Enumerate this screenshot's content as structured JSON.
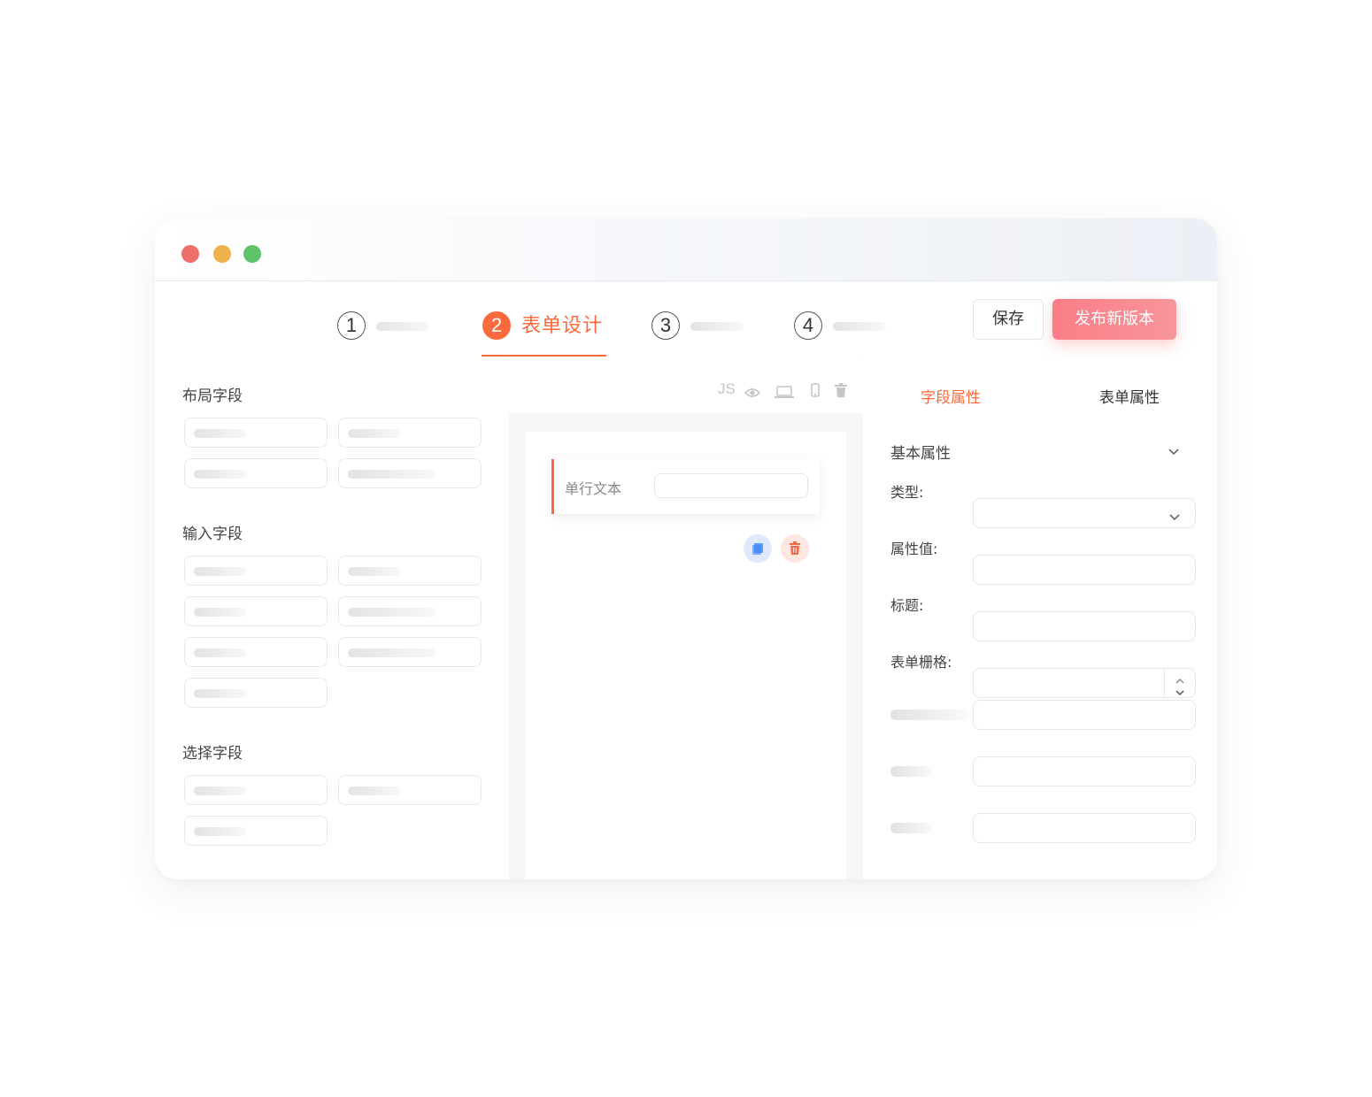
{
  "steps": [
    {
      "number": "1"
    },
    {
      "number": "2",
      "label": "表单设计",
      "active": true
    },
    {
      "number": "3"
    },
    {
      "number": "4"
    }
  ],
  "toolbar": {
    "save_label": "保存",
    "publish_label": "发布新版本"
  },
  "left_panel": {
    "groups": [
      {
        "title": "布局字段"
      },
      {
        "title": "输入字段"
      },
      {
        "title": "选择字段"
      }
    ]
  },
  "center": {
    "tools": {
      "js": "JS"
    },
    "field": {
      "label": "单行文本"
    }
  },
  "right_panel": {
    "tabs": [
      "字段属性",
      "表单属性"
    ],
    "section_title": "基本属性",
    "props": [
      {
        "label": "类型:"
      },
      {
        "label": "属性值:"
      },
      {
        "label": "标题:"
      },
      {
        "label": "表单栅格:"
      }
    ]
  },
  "colors": {
    "accent": "#fb6a3c",
    "publish": "#f7888f",
    "copy_icon": "#5b9cf8",
    "delete_icon": "#f26b4a"
  }
}
